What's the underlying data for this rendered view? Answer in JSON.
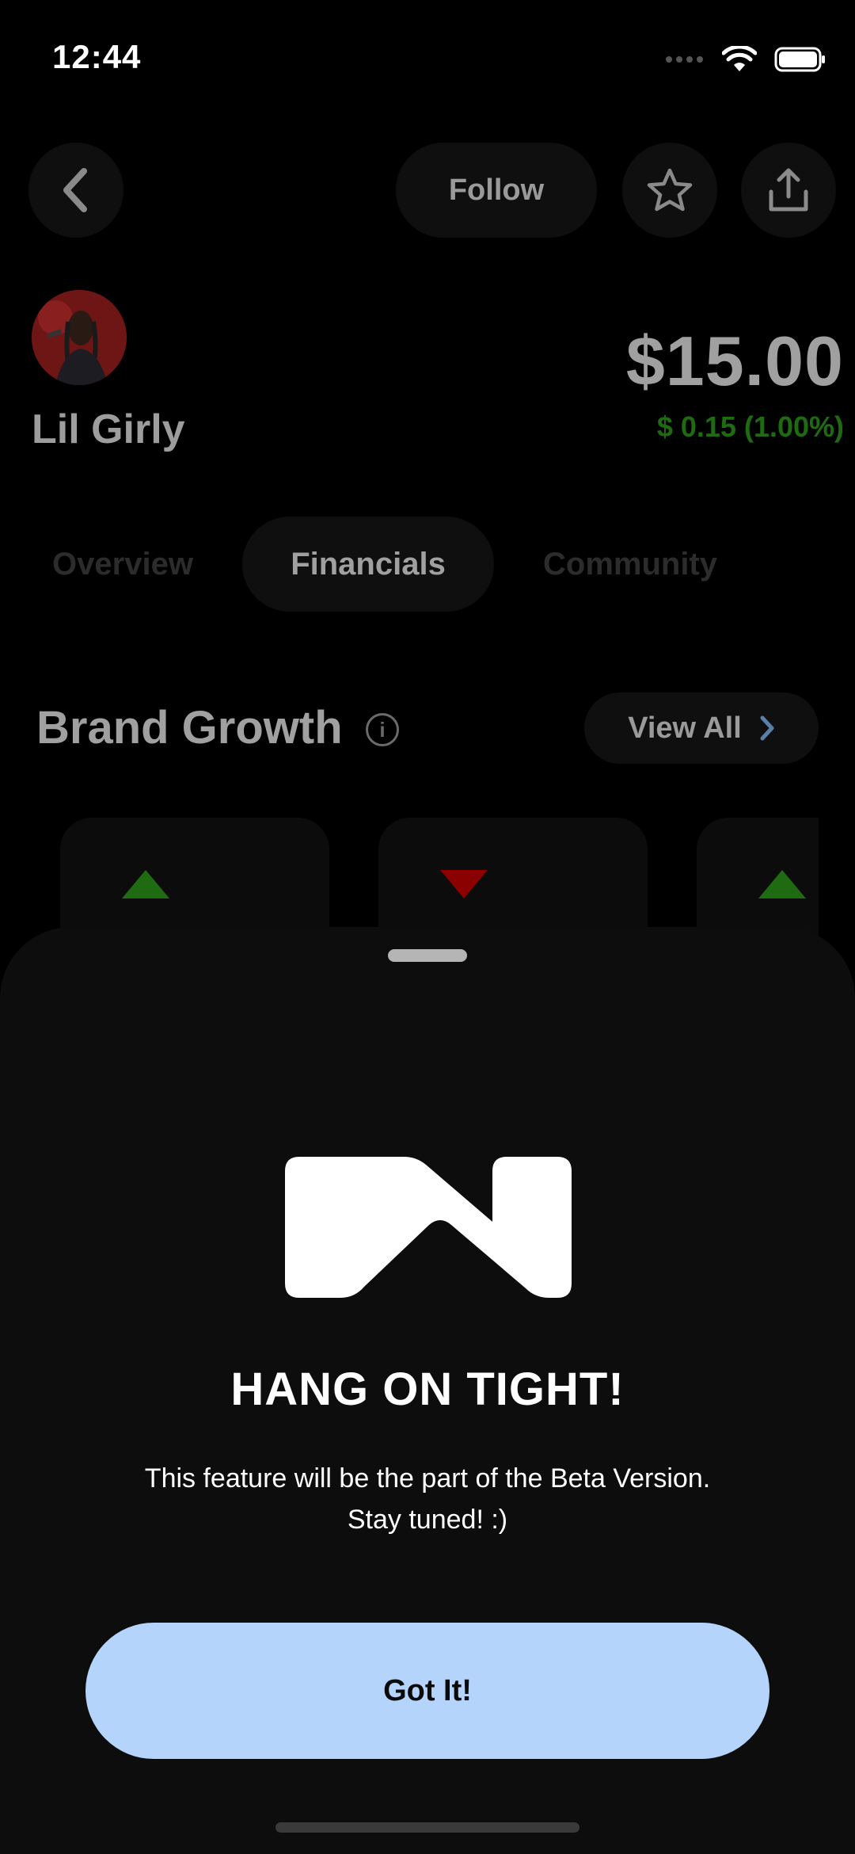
{
  "status_bar": {
    "time": "12:44"
  },
  "header": {
    "follow_label": "Follow"
  },
  "artist": {
    "name": "Lil Girly",
    "price": "$15.00",
    "change": "$ 0.15 (1.00%)"
  },
  "tabs": [
    {
      "label": "Overview"
    },
    {
      "label": "Financials"
    },
    {
      "label": "Community"
    }
  ],
  "section": {
    "title": "Brand Growth",
    "view_all": "View All"
  },
  "colors": {
    "up": "#1f6b12",
    "down": "#8b0000",
    "button": "#b5d4fb"
  },
  "sheet": {
    "title": "HANG ON TIGHT!",
    "message_line1": "This feature will be the part of the Beta Version.",
    "message_line2": "Stay tuned! :)",
    "button_label": "Got It!"
  }
}
